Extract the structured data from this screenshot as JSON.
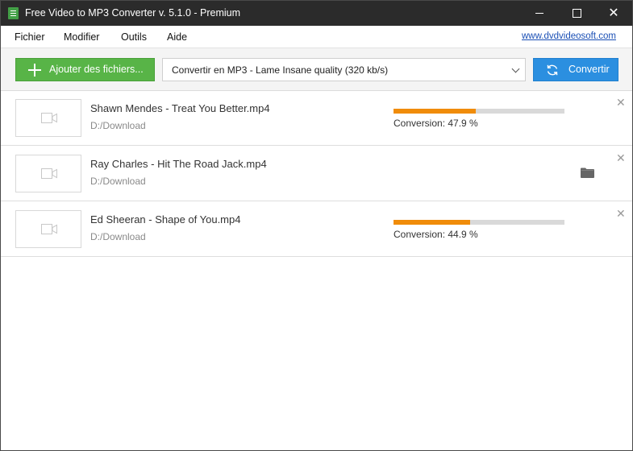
{
  "window": {
    "title": "Free Video to MP3 Converter v. 5.1.0 - Premium",
    "controls": {
      "minimize": "minimize",
      "maximize": "maximize",
      "close": "✕"
    }
  },
  "menu": {
    "items": [
      "Fichier",
      "Modifier",
      "Outils",
      "Aide"
    ],
    "site_link": "www.dvdvideosoft.com"
  },
  "toolbar": {
    "add_files_label": "Ajouter des fichiers...",
    "format_selected": "Convertir en MP3 - Lame Insane quality (320 kb/s)",
    "convert_label": "Convertir"
  },
  "files": [
    {
      "name": "Shawn Mendes - Treat You Better.mp4",
      "path": "D:/Download",
      "status": "Conversion: 47.9 %",
      "progress": 47.9
    },
    {
      "name": "Ray Charles - Hit The Road Jack.mp4",
      "path": "D:/Download",
      "status": "",
      "progress": null
    },
    {
      "name": "Ed Sheeran - Shape of You.mp4",
      "path": "D:/Download",
      "status": "Conversion: 44.9 %",
      "progress": 44.9
    }
  ],
  "colors": {
    "add_button": "#58b447",
    "convert_button": "#2b8fe0",
    "progress_fill": "#f08c0a",
    "title_bar": "#2b2b2b",
    "link": "#1a4fb5"
  },
  "icons": {
    "app": "app-icon",
    "add": "plus-icon",
    "convert": "refresh-icon",
    "dropdown": "chevron-down-icon",
    "thumbnail": "video-camera-icon",
    "remove": "close-icon",
    "open_folder": "folder-icon"
  }
}
